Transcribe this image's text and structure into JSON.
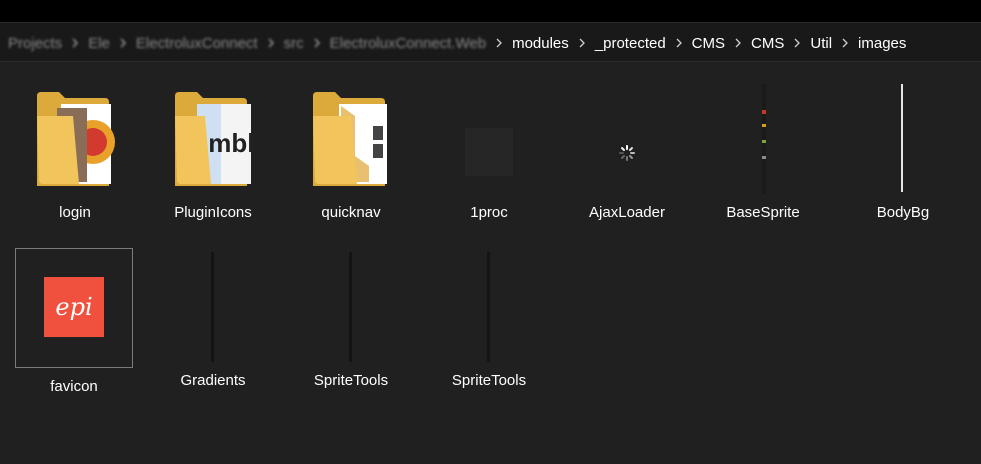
{
  "breadcrumb": {
    "blurred": [
      "Projects",
      "Ele",
      "ElectroluxConnect",
      "src",
      "ElectroluxConnect.Web"
    ],
    "items": [
      "modules",
      "_protected",
      "CMS",
      "CMS",
      "Util",
      "images"
    ]
  },
  "files": [
    {
      "name": "login",
      "icon": "folder-icon"
    },
    {
      "name": "PluginIcons",
      "icon": "folder-icon"
    },
    {
      "name": "quicknav",
      "icon": "folder-icon"
    },
    {
      "name": "1proc",
      "icon": "image-thumbnail-icon"
    },
    {
      "name": "AjaxLoader",
      "icon": "spinner-icon"
    },
    {
      "name": "BaseSprite",
      "icon": "sprite-thumbnail-icon"
    },
    {
      "name": "BodyBg",
      "icon": "line-thumbnail-icon"
    },
    {
      "name": "favicon",
      "icon": "epi-logo-icon"
    },
    {
      "name": "Gradients",
      "icon": "line-thumbnail-icon"
    },
    {
      "name": "SpriteTools",
      "icon": "line-thumbnail-icon"
    },
    {
      "name": "SpriteTools",
      "icon": "line-thumbnail-icon"
    }
  ],
  "favicon_text": "epi",
  "preview_text": "imbl",
  "colors": {
    "folder": "#f2c55c",
    "folder_dark": "#dca93b",
    "epi": "#f0513f",
    "background": "#202020"
  }
}
